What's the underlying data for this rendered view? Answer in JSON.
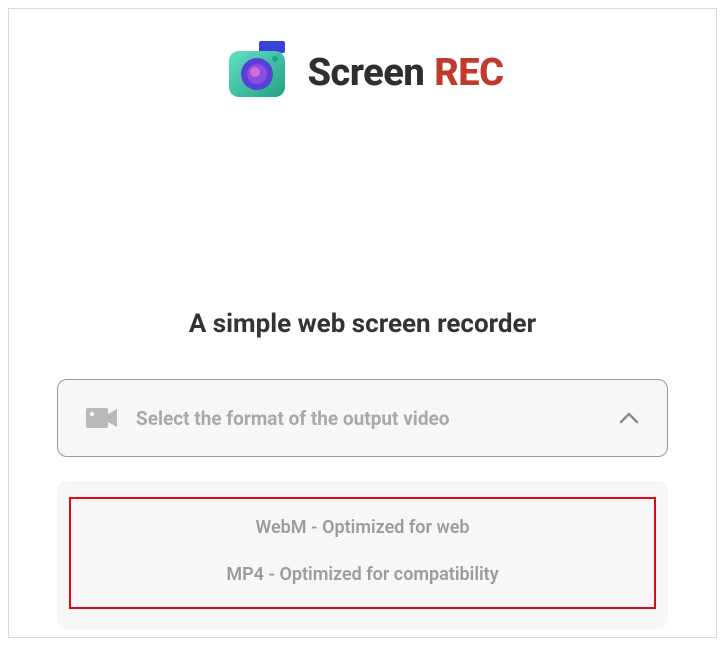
{
  "brand": {
    "word1": "Screen",
    "word2": "REC"
  },
  "tagline": "A simple web screen recorder",
  "select": {
    "placeholder": "Select the format of the output video"
  },
  "options": {
    "webm": "WebM - Optimized for web",
    "mp4": "MP4 - Optimized for compatibility"
  }
}
